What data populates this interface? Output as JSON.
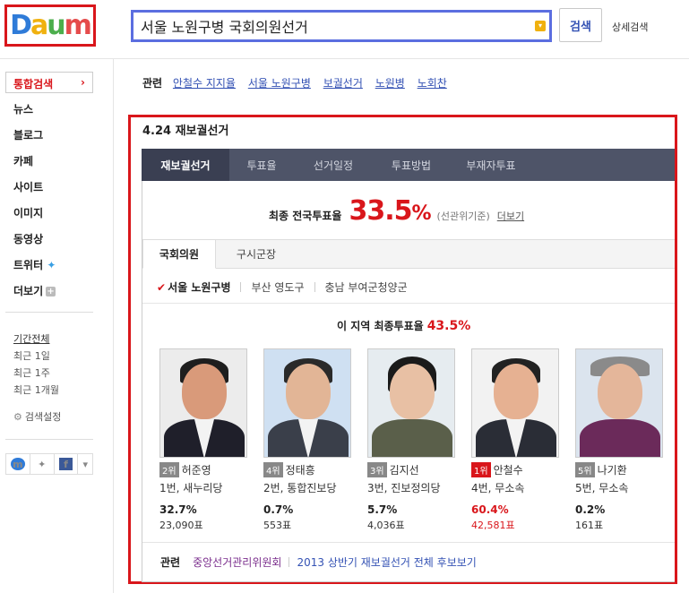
{
  "header": {
    "logo": "Daum",
    "search_value": "서울 노원구병 국회의원선거",
    "search_button": "검색",
    "advanced_search": "상세검색"
  },
  "sidebar": {
    "first": "통합검색",
    "items": [
      "뉴스",
      "블로그",
      "카페",
      "사이트",
      "이미지",
      "동영상",
      "트위터",
      "더보기"
    ],
    "period": [
      "기간전체",
      "최근 1일",
      "최근 1주",
      "최근 1개월"
    ],
    "settings": "검색설정"
  },
  "related_top": {
    "label": "관련",
    "links": [
      "안철수 지지율",
      "서울 노원구병",
      "보궐선거",
      "노원병",
      "노회찬"
    ]
  },
  "section_title": "4.24 재보궐선거",
  "tabs": [
    "재보궐선거",
    "투표율",
    "선거일정",
    "투표방법",
    "부재자투표"
  ],
  "turnout": {
    "label": "최종 전국투표율",
    "value": "33.5",
    "unit": "%",
    "note": "(선관위기준)",
    "more": "더보기"
  },
  "sub_tabs": [
    "국회의원",
    "구시군장"
  ],
  "districts": [
    "서울 노원구병",
    "부산 영도구",
    "충남 부여군청양군"
  ],
  "area_turnout": {
    "label": "이 지역 최종투표율",
    "value": "43.5%"
  },
  "candidates": [
    {
      "rank": "2위",
      "name": "허준영",
      "party": "1번, 새누리당",
      "pct": "32.7%",
      "votes": "23,090표",
      "winner": false
    },
    {
      "rank": "4위",
      "name": "정태흥",
      "party": "2번, 통합진보당",
      "pct": "0.7%",
      "votes": "553표",
      "winner": false
    },
    {
      "rank": "3위",
      "name": "김지선",
      "party": "3번, 진보정의당",
      "pct": "5.7%",
      "votes": "4,036표",
      "winner": false
    },
    {
      "rank": "1위",
      "name": "안철수",
      "party": "4번, 무소속",
      "pct": "60.4%",
      "votes": "42,581표",
      "winner": true
    },
    {
      "rank": "5위",
      "name": "나기환",
      "party": "5번, 무소속",
      "pct": "0.2%",
      "votes": "161표",
      "winner": false
    }
  ],
  "bottom_related": {
    "label": "관련",
    "links": [
      "중앙선거관리위원회",
      "2013 상반기 재보궐선거 전체 후보보기"
    ]
  },
  "colors": {
    "accent_red": "#d9161b",
    "link_blue": "#3452b4",
    "tab_bar": "#4e5468"
  }
}
